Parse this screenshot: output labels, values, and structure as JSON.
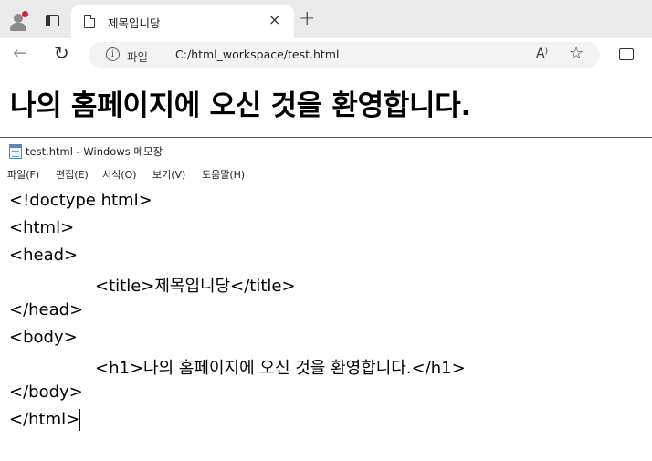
{
  "browser": {
    "tab": {
      "title": "제목입니당",
      "close": "×"
    },
    "new_tab": "+",
    "toolbar": {
      "back": "←",
      "reload": "↻",
      "info": "i",
      "scheme_label": "파일",
      "url": "C:/html_workspace/test.html",
      "read_aloud": "A⁾",
      "favorite": "☆"
    },
    "icons": {
      "profile": "profile-icon",
      "tab_strip": "tab-strip-icon",
      "document": "document-icon",
      "split_screen": "split-screen-icon"
    },
    "accent_notification": "#d6202b"
  },
  "page": {
    "heading": "나의 홈페이지에 오신 것을 환영합니다."
  },
  "notepad": {
    "title": "test.html - Windows 메모장",
    "menu": [
      "파일(F)",
      "편집(E)",
      "서식(O)",
      "보기(V)",
      "도움말(H)"
    ],
    "lines": [
      "<!doctype html>",
      "<html>",
      "<head>",
      "<title>제목입니당</title>",
      "</head>",
      "<body>",
      "<h1>나의 홈페이지에 오신 것을 환영합니다.</h1>",
      "</body>",
      "</html>"
    ]
  }
}
